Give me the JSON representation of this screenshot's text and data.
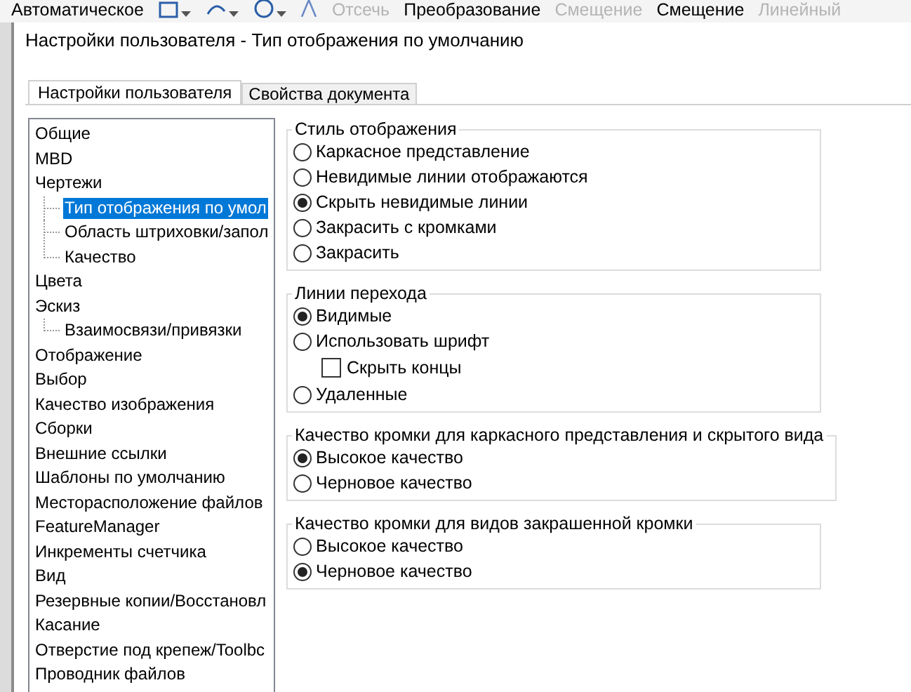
{
  "toolbar": [
    {
      "label": "Автоматическое",
      "disabled": false
    },
    {
      "label": "Отсечь",
      "disabled": true
    },
    {
      "label": "Преобразование",
      "disabled": false
    },
    {
      "label": "Смещение",
      "disabled": true
    },
    {
      "label": "Смещение",
      "disabled": false
    },
    {
      "label": "Линейный",
      "disabled": true
    }
  ],
  "window": {
    "title": "Настройки пользователя - Тип отображения по умолчанию"
  },
  "tabs": [
    {
      "label": "Настройки пользователя",
      "selected": true
    },
    {
      "label": "Свойства документа",
      "selected": false
    }
  ],
  "tree": [
    {
      "label": "Общие",
      "selected": false
    },
    {
      "label": "MBD",
      "selected": false
    },
    {
      "label": "Чертежи",
      "selected": false,
      "children": [
        {
          "label": "Тип отображения по умол",
          "selected": true
        },
        {
          "label": "Область штриховки/запол",
          "selected": false
        },
        {
          "label": "Качество",
          "selected": false
        }
      ]
    },
    {
      "label": "Цвета",
      "selected": false
    },
    {
      "label": "Эскиз",
      "selected": false,
      "children": [
        {
          "label": "Взаимосвязи/привязки",
          "selected": false
        }
      ]
    },
    {
      "label": "Отображение",
      "selected": false
    },
    {
      "label": "Выбор",
      "selected": false
    },
    {
      "label": "Качество изображения",
      "selected": false
    },
    {
      "label": "Сборки",
      "selected": false
    },
    {
      "label": "Внешние ссылки",
      "selected": false
    },
    {
      "label": "Шаблоны по умолчанию",
      "selected": false
    },
    {
      "label": "Месторасположение файлов",
      "selected": false
    },
    {
      "label": "FeatureManager",
      "selected": false
    },
    {
      "label": "Инкременты счетчика",
      "selected": false
    },
    {
      "label": "Вид",
      "selected": false
    },
    {
      "label": "Резервные копии/Восстановл",
      "selected": false
    },
    {
      "label": "Касание",
      "selected": false
    },
    {
      "label": "Отверстие под крепеж/Toolbc",
      "selected": false
    },
    {
      "label": "Проводник файлов",
      "selected": false
    }
  ],
  "groups": [
    {
      "title": "Стиль отображения",
      "options": [
        {
          "kind": "radio",
          "label": "Каркасное представление",
          "selected": false
        },
        {
          "kind": "radio",
          "label": "Невидимые линии отображаются",
          "selected": false
        },
        {
          "kind": "radio",
          "label": "Скрыть невидимые линии",
          "selected": true
        },
        {
          "kind": "radio",
          "label": "Закрасить с кромками",
          "selected": false
        },
        {
          "kind": "radio",
          "label": "Закрасить",
          "selected": false
        }
      ]
    },
    {
      "title": "Линии перехода",
      "options": [
        {
          "kind": "radio",
          "label": "Видимые",
          "selected": true
        },
        {
          "kind": "radio",
          "label": "Использовать шрифт",
          "selected": false
        },
        {
          "kind": "checkbox",
          "label": "Скрыть концы",
          "checked": false
        },
        {
          "kind": "radio",
          "label": "Удаленные",
          "selected": false
        }
      ]
    },
    {
      "title": "Качество кромки для каркасного представления и скрытого вида",
      "options": [
        {
          "kind": "radio",
          "label": "Высокое качество",
          "selected": true
        },
        {
          "kind": "radio",
          "label": "Черновое качество",
          "selected": false
        }
      ]
    },
    {
      "title": "Качество кромки для видов закрашенной кромки",
      "options": [
        {
          "kind": "radio",
          "label": "Высокое качество",
          "selected": false
        },
        {
          "kind": "radio",
          "label": "Черновое качество",
          "selected": true
        }
      ]
    }
  ]
}
